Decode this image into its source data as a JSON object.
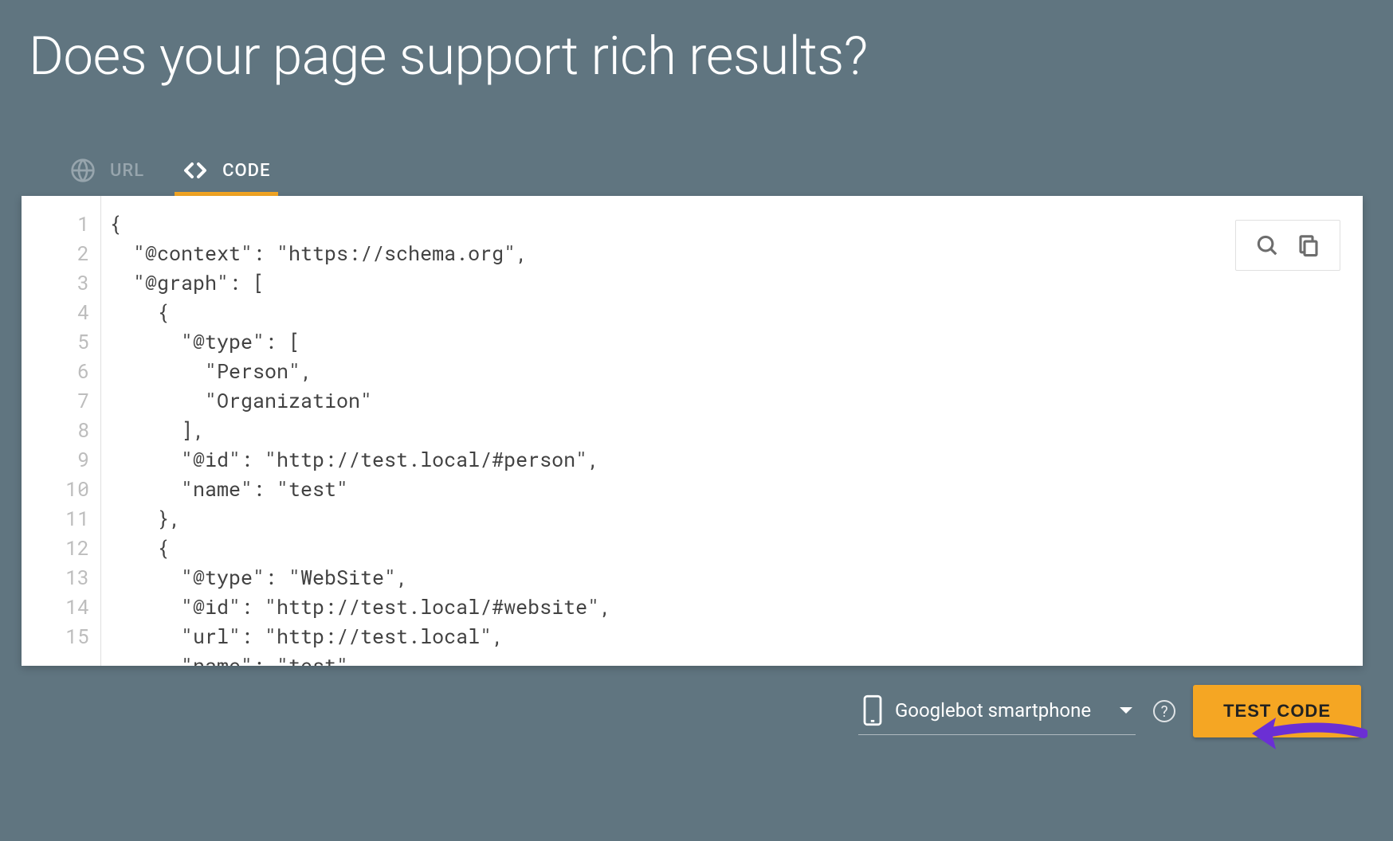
{
  "heading": "Does your page support rich results?",
  "tabs": {
    "url_label": "URL",
    "code_label": "CODE"
  },
  "code": {
    "lines": [
      "{",
      "  \"@context\": \"https://schema.org\",",
      "  \"@graph\": [",
      "    {",
      "      \"@type\": [",
      "        \"Person\",",
      "        \"Organization\"",
      "      ],",
      "      \"@id\": \"http://test.local/#person\",",
      "      \"name\": \"test\"",
      "    },",
      "    {",
      "      \"@type\": \"WebSite\",",
      "      \"@id\": \"http://test.local/#website\",",
      "      \"url\": \"http://test.local\",",
      "      \"name\": \"test\""
    ]
  },
  "bot_selector": {
    "selected_label": "Googlebot smartphone"
  },
  "test_button_label": "TEST CODE",
  "colors": {
    "accent": "#f5a623",
    "background": "#607580",
    "annotation_arrow": "#6b2fd4"
  },
  "icons": {
    "tab_url": "globe-icon",
    "tab_code": "code-brackets-icon",
    "search": "search-icon",
    "copy": "copy-icon",
    "device": "smartphone-icon",
    "dropdown": "chevron-down-icon",
    "help": "help-icon"
  }
}
